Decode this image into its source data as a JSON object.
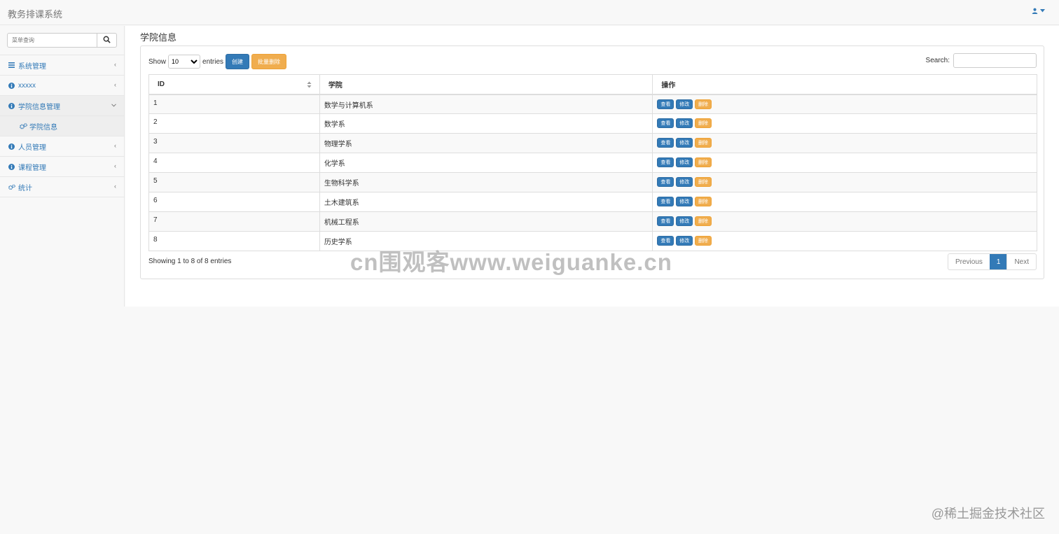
{
  "app": {
    "title": "教务排课系统"
  },
  "sidebar": {
    "search_placeholder": "菜单查询",
    "items": [
      {
        "label": "系统管理",
        "icon": "bars-icon"
      },
      {
        "label": "xxxxx",
        "icon": "info-circle-icon"
      },
      {
        "label": "学院信息管理",
        "icon": "info-circle-icon",
        "expanded": true,
        "children": [
          {
            "label": "学院信息",
            "icon": "gears-icon"
          }
        ]
      },
      {
        "label": "人员管理",
        "icon": "info-circle-icon"
      },
      {
        "label": "课程管理",
        "icon": "info-circle-icon"
      },
      {
        "label": "统计",
        "icon": "gears-icon"
      }
    ]
  },
  "main": {
    "title": "学院信息",
    "show_label": "Show",
    "entries_value": "10",
    "entries_label": "entries",
    "create_label": "创建",
    "batch_delete_label": "批量删除",
    "search_label": "Search:",
    "table": {
      "headers": [
        "ID",
        "学院",
        "操作"
      ],
      "rows": [
        {
          "id": "1",
          "name": "数学与计算机系"
        },
        {
          "id": "2",
          "name": "数学系"
        },
        {
          "id": "3",
          "name": "物理学系"
        },
        {
          "id": "4",
          "name": "化学系"
        },
        {
          "id": "5",
          "name": "生物科学系"
        },
        {
          "id": "6",
          "name": "土木建筑系"
        },
        {
          "id": "7",
          "name": "机械工程系"
        },
        {
          "id": "8",
          "name": "历史学系"
        }
      ],
      "actions": {
        "view": "查看",
        "edit": "修改",
        "delete": "删除"
      }
    },
    "info": "Showing 1 to 8 of 8 entries",
    "pagination": {
      "previous": "Previous",
      "current": "1",
      "next": "Next"
    }
  },
  "watermarks": {
    "center": "cn围观客www.weiguanke.cn",
    "corner": "@稀土掘金技术社区"
  },
  "colors": {
    "primary": "#337ab7",
    "warning": "#f0ad4e"
  }
}
